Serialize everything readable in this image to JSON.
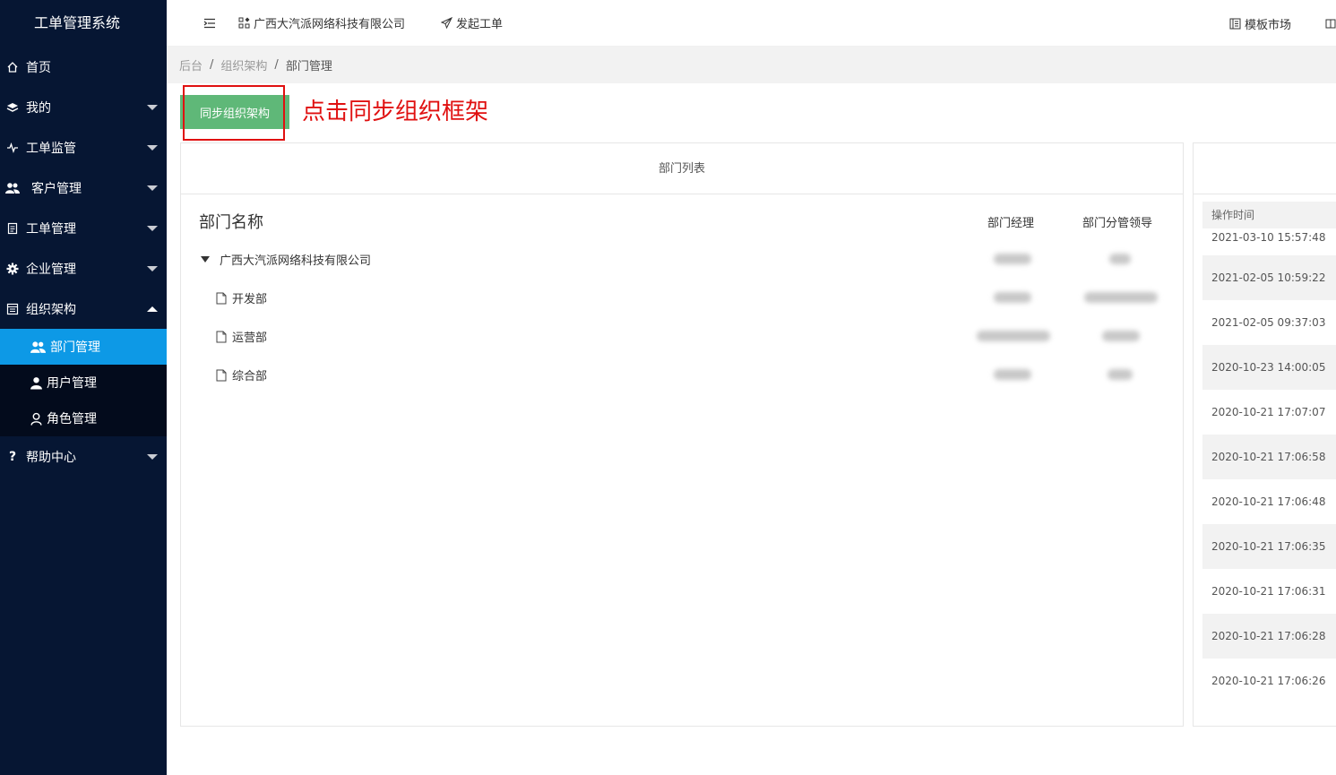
{
  "sidebar": {
    "title": "工单管理系统",
    "items": [
      {
        "label": "首页",
        "icon": "home-icon"
      },
      {
        "label": "我的",
        "icon": "layers-icon"
      },
      {
        "label": "工单监管",
        "icon": "pulse-icon"
      },
      {
        "label": "客户管理",
        "icon": "users-icon"
      },
      {
        "label": "工单管理",
        "icon": "clipboard-icon"
      },
      {
        "label": "企业管理",
        "icon": "gear-icon"
      },
      {
        "label": "组织架构",
        "icon": "org-icon"
      },
      {
        "label": "帮助中心",
        "icon": "question-icon"
      }
    ],
    "submenu": [
      {
        "label": "部门管理",
        "icon": "users-icon",
        "active": true
      },
      {
        "label": "用户管理",
        "icon": "user-icon"
      },
      {
        "label": "角色管理",
        "icon": "user-outline-icon"
      }
    ]
  },
  "topbar": {
    "company": "广西大汽派网络科技有限公司",
    "new_ticket": "发起工单",
    "template_market": "模板市场"
  },
  "breadcrumb": [
    "后台",
    "组织架构",
    "部门管理"
  ],
  "breadcrumb_sep": "/",
  "sync_button": "同步组织架构",
  "annotation": "点击同步组织框架",
  "dept_panel": {
    "title": "部门列表",
    "col_name": "部门名称",
    "col_manager": "部门经理",
    "col_leader": "部门分管领导",
    "root": "广西大汽派网络科技有限公司",
    "children": [
      "开发部",
      "运营部",
      "综合部"
    ]
  },
  "log_panel": {
    "col_time": "操作时间",
    "times": [
      "2021-03-10 15:57:48",
      "2021-02-05 10:59:22",
      "2021-02-05 09:37:03",
      "2020-10-23 14:00:05",
      "2020-10-21 17:07:07",
      "2020-10-21 17:06:58",
      "2020-10-21 17:06:48",
      "2020-10-21 17:06:35",
      "2020-10-21 17:06:31",
      "2020-10-21 17:06:28",
      "2020-10-21 17:06:26"
    ]
  },
  "colors": {
    "sidebar_bg": "#061633",
    "active_item": "#0d99e6",
    "sync_button": "#5fb878",
    "annotation": "#e01010"
  }
}
